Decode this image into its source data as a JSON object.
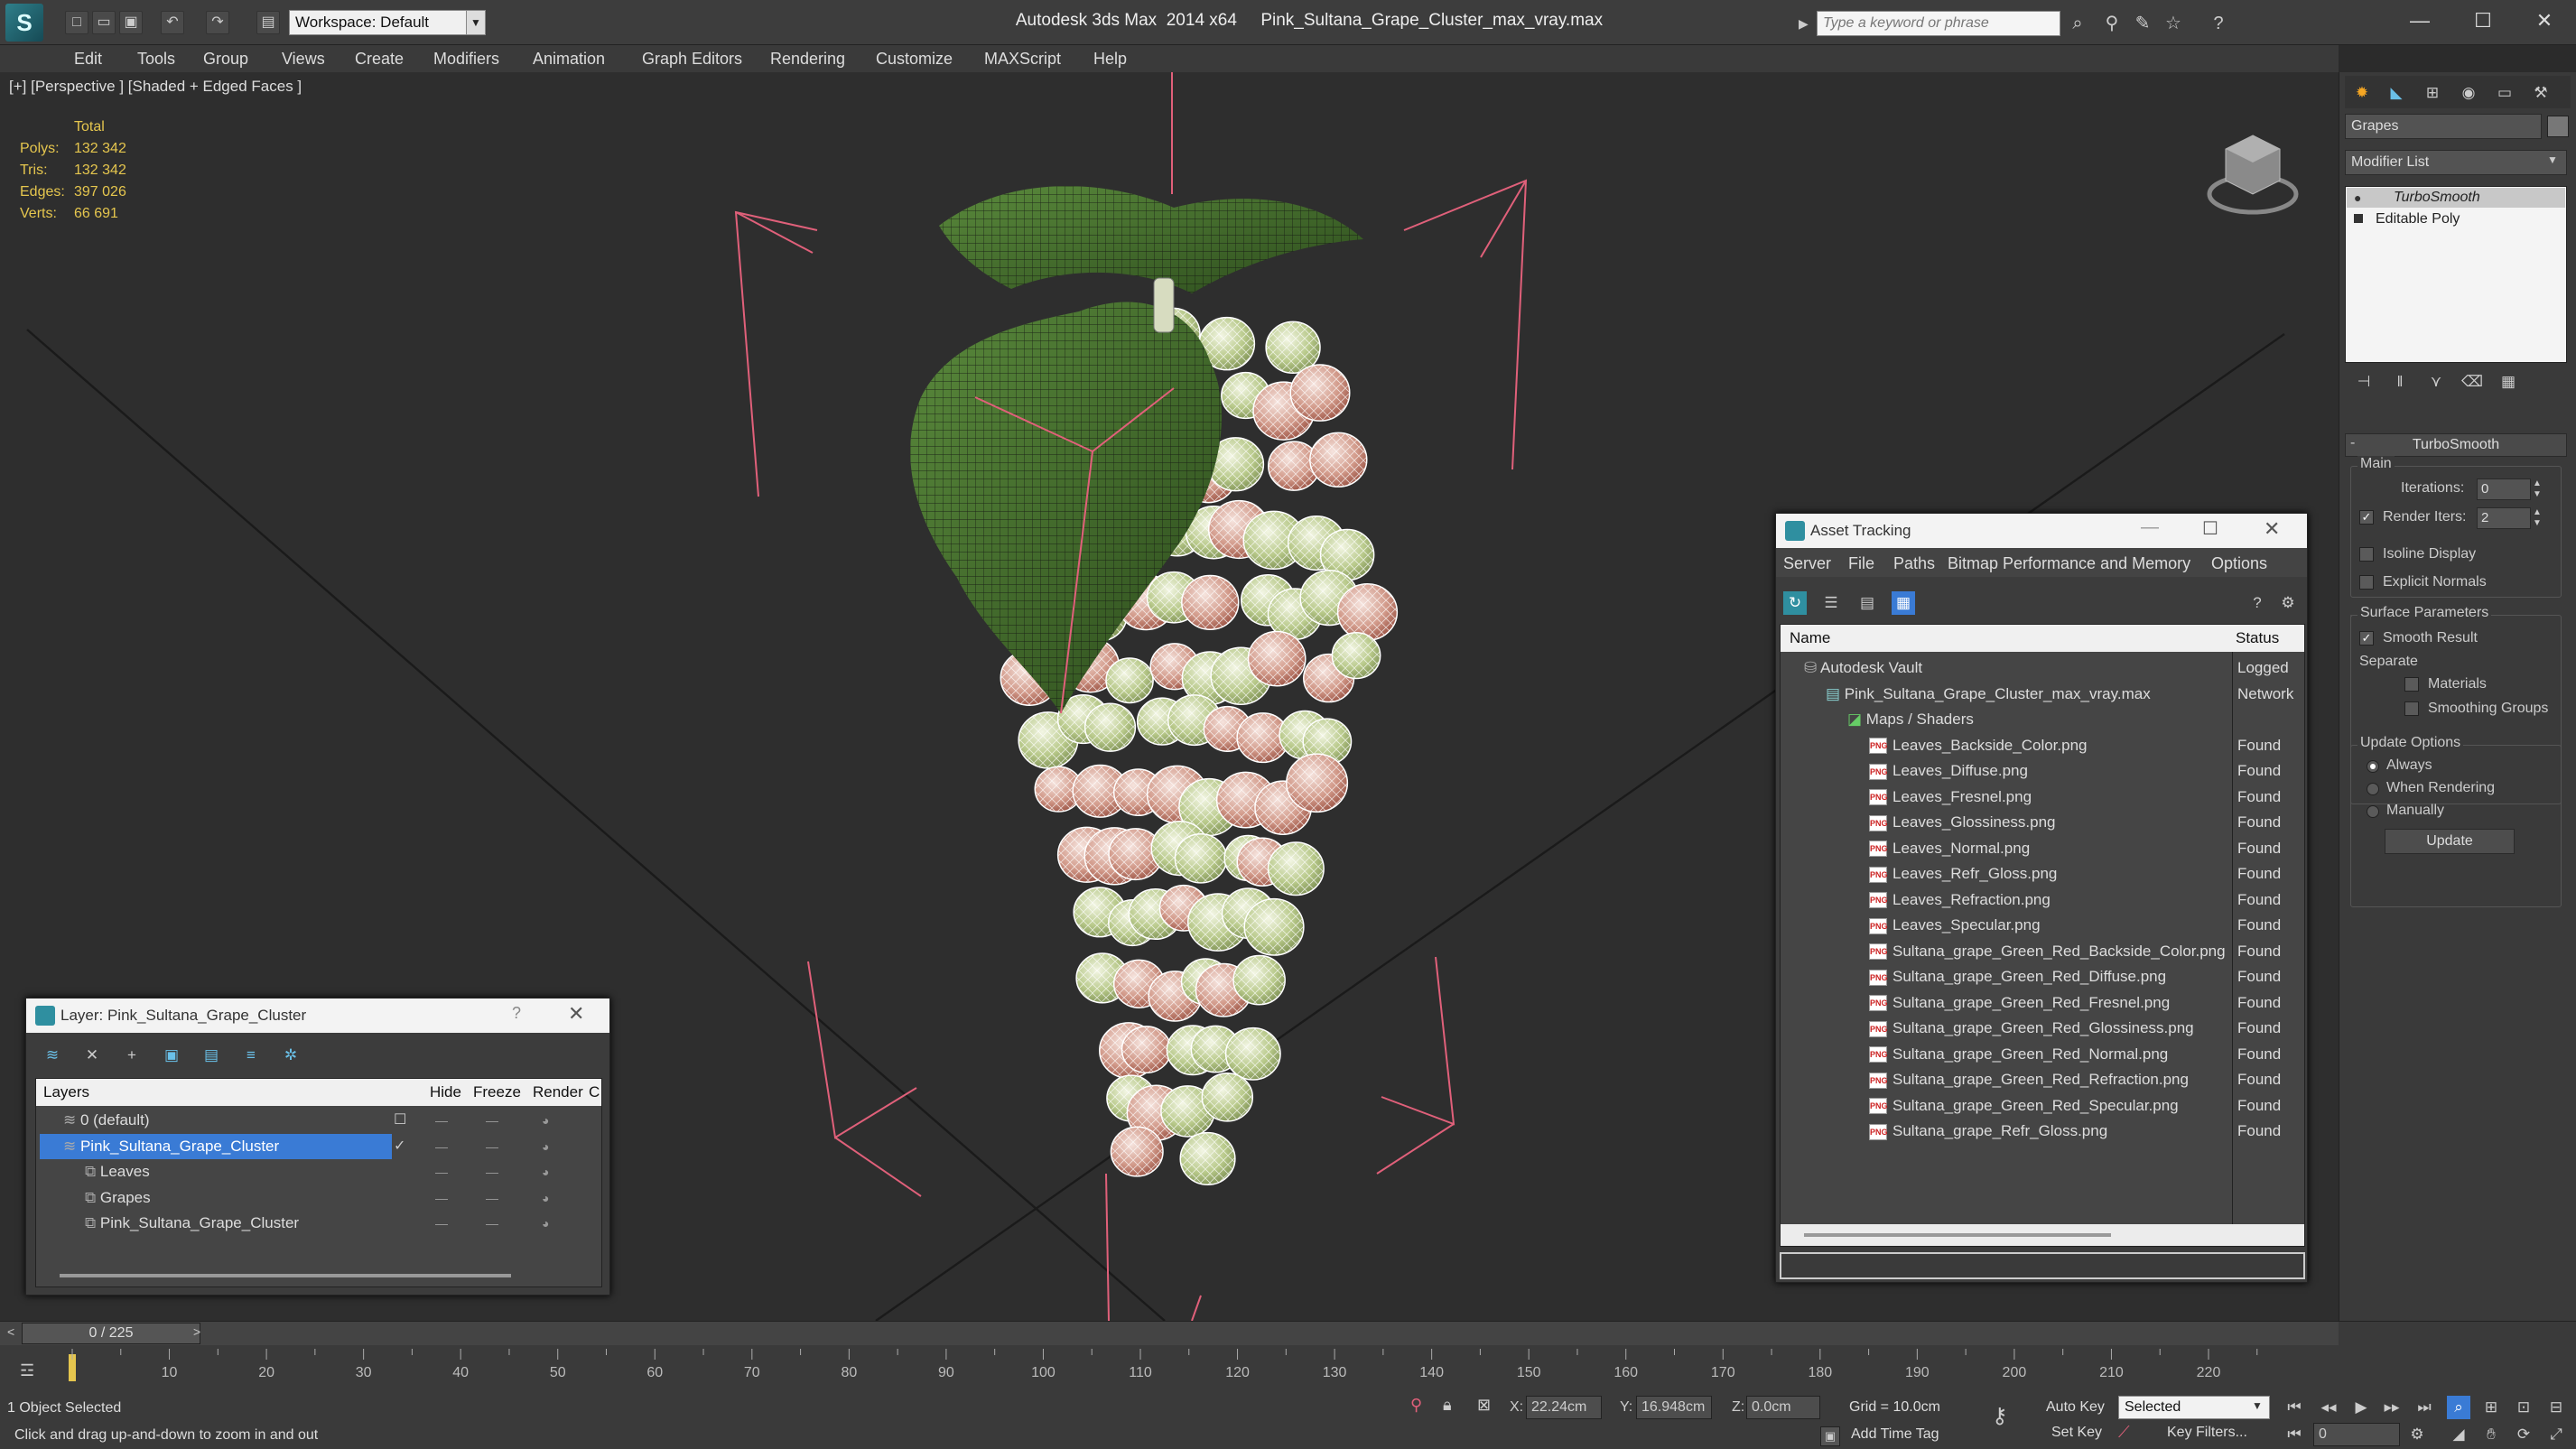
{
  "titlebar": {
    "workspace": "Workspace: Default",
    "app": "Autodesk 3ds Max  2014 x64",
    "file": "Pink_Sultana_Grape_Cluster_max_vray.max",
    "search_placeholder": "Type a keyword or phrase"
  },
  "menu": [
    "Edit",
    "Tools",
    "Group",
    "Views",
    "Create",
    "Modifiers",
    "Animation",
    "Graph Editors",
    "Rendering",
    "Customize",
    "MAXScript",
    "Help"
  ],
  "viewport": {
    "label": "[+] [Perspective ] [Shaded + Edged Faces ]",
    "stats": {
      "total_label": "Total",
      "rows": [
        {
          "label": "Polys:",
          "value": "132 342"
        },
        {
          "label": "Tris:",
          "value": "132 342"
        },
        {
          "label": "Edges:",
          "value": "397 026"
        },
        {
          "label": "Verts:",
          "value": "66 691"
        }
      ]
    }
  },
  "command_panel": {
    "object_name": "Grapes",
    "modifier_list": "Modifier List",
    "stack": [
      "TurboSmooth",
      "Editable Poly"
    ],
    "rollout": "TurboSmooth",
    "main": "Main",
    "iterations_label": "Iterations:",
    "iterations": "0",
    "render_iters_label": "Render Iters:",
    "render_iters": "2",
    "isoline": "Isoline Display",
    "explicit_normals": "Explicit Normals",
    "surface_params": "Surface Parameters",
    "smooth_result": "Smooth Result",
    "separate": "Separate",
    "materials": "Materials",
    "smoothing_groups": "Smoothing Groups",
    "update_options": "Update Options",
    "always": "Always",
    "when_rendering": "When Rendering",
    "manually": "Manually",
    "update": "Update"
  },
  "asset_tracking": {
    "title": "Asset Tracking",
    "menu": [
      "Server",
      "File",
      "Paths",
      "Bitmap Performance and Memory",
      "Options"
    ],
    "col_name": "Name",
    "col_status": "Status",
    "rows": [
      {
        "name": "Autodesk Vault",
        "status": "Logged",
        "level": 0,
        "kind": "vault"
      },
      {
        "name": "Pink_Sultana_Grape_Cluster_max_vray.max",
        "status": "Network",
        "level": 1,
        "kind": "max"
      },
      {
        "name": "Maps / Shaders",
        "status": "",
        "level": 2,
        "kind": "maps"
      },
      {
        "name": "Leaves_Backside_Color.png",
        "status": "Found",
        "level": 3,
        "kind": "png"
      },
      {
        "name": "Leaves_Diffuse.png",
        "status": "Found",
        "level": 3,
        "kind": "png"
      },
      {
        "name": "Leaves_Fresnel.png",
        "status": "Found",
        "level": 3,
        "kind": "png"
      },
      {
        "name": "Leaves_Glossiness.png",
        "status": "Found",
        "level": 3,
        "kind": "png"
      },
      {
        "name": "Leaves_Normal.png",
        "status": "Found",
        "level": 3,
        "kind": "png"
      },
      {
        "name": "Leaves_Refr_Gloss.png",
        "status": "Found",
        "level": 3,
        "kind": "png"
      },
      {
        "name": "Leaves_Refraction.png",
        "status": "Found",
        "level": 3,
        "kind": "png"
      },
      {
        "name": "Leaves_Specular.png",
        "status": "Found",
        "level": 3,
        "kind": "png"
      },
      {
        "name": "Sultana_grape_Green_Red_Backside_Color.png",
        "status": "Found",
        "level": 3,
        "kind": "png"
      },
      {
        "name": "Sultana_grape_Green_Red_Diffuse.png",
        "status": "Found",
        "level": 3,
        "kind": "png"
      },
      {
        "name": "Sultana_grape_Green_Red_Fresnel.png",
        "status": "Found",
        "level": 3,
        "kind": "png"
      },
      {
        "name": "Sultana_grape_Green_Red_Glossiness.png",
        "status": "Found",
        "level": 3,
        "kind": "png"
      },
      {
        "name": "Sultana_grape_Green_Red_Normal.png",
        "status": "Found",
        "level": 3,
        "kind": "png"
      },
      {
        "name": "Sultana_grape_Green_Red_Refraction.png",
        "status": "Found",
        "level": 3,
        "kind": "png"
      },
      {
        "name": "Sultana_grape_Green_Red_Specular.png",
        "status": "Found",
        "level": 3,
        "kind": "png"
      },
      {
        "name": "Sultana_grape_Refr_Gloss.png",
        "status": "Found",
        "level": 3,
        "kind": "png"
      }
    ]
  },
  "layer_window": {
    "title": "Layer: Pink_Sultana_Grape_Cluster",
    "help": "?",
    "col_layers": "Layers",
    "col_hide": "Hide",
    "col_freeze": "Freeze",
    "col_render": "Render",
    "col_more": "C",
    "rows": [
      {
        "name": "0 (default)",
        "level": 0,
        "selected": false
      },
      {
        "name": "Pink_Sultana_Grape_Cluster",
        "level": 0,
        "selected": true
      },
      {
        "name": "Leaves",
        "level": 1,
        "selected": false
      },
      {
        "name": "Grapes",
        "level": 1,
        "selected": false
      },
      {
        "name": "Pink_Sultana_Grape_Cluster",
        "level": 1,
        "selected": false
      }
    ]
  },
  "timeline": {
    "frame": "0 / 225",
    "ticks": [
      "10",
      "20",
      "30",
      "40",
      "50",
      "60",
      "70",
      "80",
      "90",
      "100",
      "110",
      "120",
      "130",
      "140",
      "150",
      "160",
      "170",
      "180",
      "190",
      "200",
      "210",
      "220"
    ]
  },
  "statusbar": {
    "selection": "1 Object Selected",
    "prompt": "Click and drag up-and-down to zoom in and out",
    "x_label": "X:",
    "x": "22.24cm",
    "y_label": "Y:",
    "y": "16.948cm",
    "z_label": "Z:",
    "z": "0.0cm",
    "grid": "Grid = 10.0cm",
    "auto_key": "Auto Key",
    "set_key": "Set Key",
    "selected": "Selected",
    "key_filters": "Key Filters...",
    "add_time_tag": "Add Time Tag",
    "frame_field": "0"
  },
  "colors": {
    "selection": "#3a7bd5",
    "stats": "#e5c64e",
    "helper": "#e0607a"
  }
}
